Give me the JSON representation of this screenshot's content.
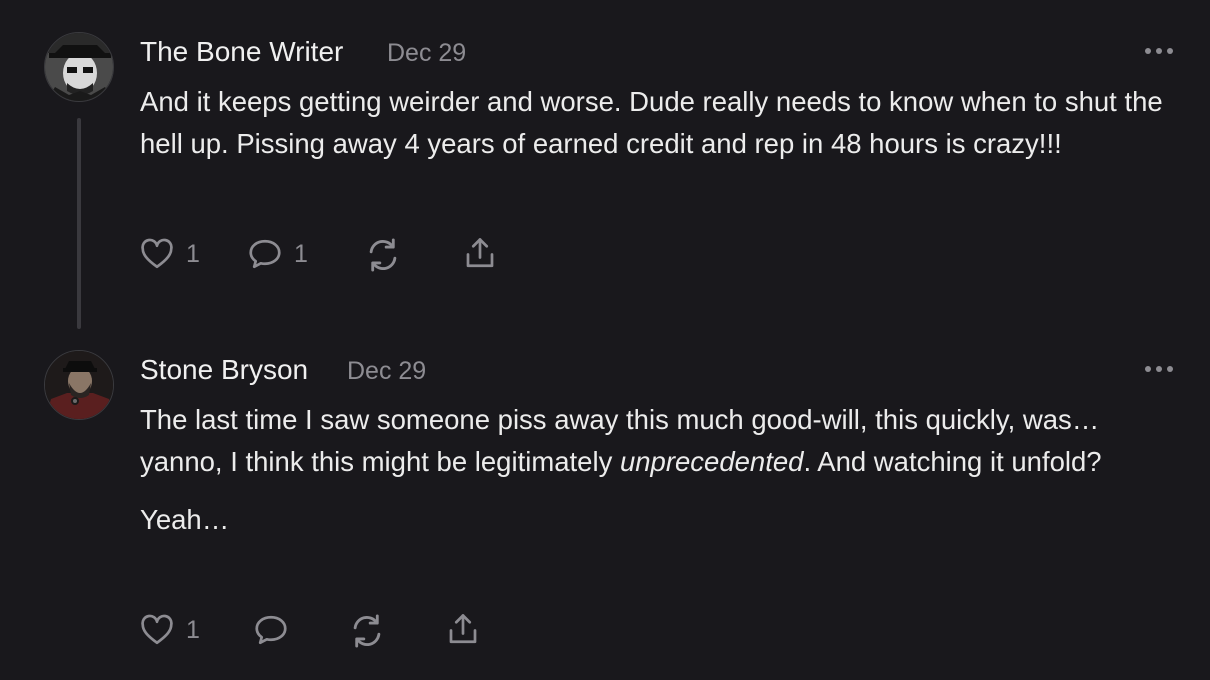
{
  "comments": [
    {
      "author": "The Bone Writer",
      "date": "Dec 29",
      "paragraphs": [
        "And it keeps getting weirder and worse. Dude really needs to know when to shut the hell up. Pissing away 4 years of earned credit and rep in 48 hours is crazy!!!"
      ],
      "like_count": "1",
      "reply_count": "1",
      "icons": {
        "like": "heart-icon",
        "reply": "comment-icon",
        "restack": "restack-icon",
        "share": "share-icon",
        "more": "more-icon"
      }
    },
    {
      "author": "Stone Bryson",
      "date": "Dec 29",
      "text_before_italic": "The last time I saw someone piss away this much good-will, this quickly, was… yanno, I think this might be legitimately ",
      "italic_text": "unprecedented",
      "text_after_italic": ". And watching it unfold?",
      "paragraph_2": "Yeah…",
      "like_count": "1",
      "icons": {
        "like": "heart-icon",
        "reply": "comment-icon",
        "restack": "restack-icon",
        "share": "share-icon",
        "more": "more-icon"
      }
    }
  ],
  "colors": {
    "background": "#19181c",
    "text": "#ececec",
    "muted": "#8d8c92",
    "thread_line": "#3a393e"
  }
}
